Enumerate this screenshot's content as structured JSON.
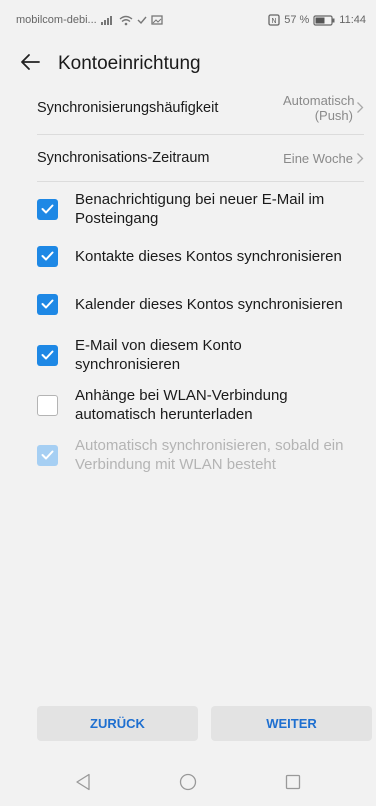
{
  "status_bar": {
    "carrier": "mobilcom-debi...",
    "battery_percent": "57 %",
    "time": "11:44"
  },
  "header": {
    "title": "Kontoeinrichtung"
  },
  "settings": {
    "sync_frequency": {
      "label": "Synchronisierungshäufigkeit",
      "value_line1": "Automatisch",
      "value_line2": "(Push)"
    },
    "sync_period": {
      "label": "Synchronisations-Zeitraum",
      "value": "Eine Woche"
    }
  },
  "options": [
    {
      "line1": "Benachrichtigung bei neuer E-Mail im",
      "line2": "Posteingang",
      "checked": true,
      "disabled": false
    },
    {
      "line1": "Kontakte dieses Kontos synchronisieren",
      "line2": "",
      "checked": true,
      "disabled": false
    },
    {
      "line1": "Kalender dieses Kontos synchronisieren",
      "line2": "",
      "checked": true,
      "disabled": false
    },
    {
      "line1": "E-Mail von diesem Konto",
      "line2": "synchronisieren",
      "checked": true,
      "disabled": false
    },
    {
      "line1": "Anhänge bei WLAN-Verbindung",
      "line2": "automatisch herunterladen",
      "checked": false,
      "disabled": false
    },
    {
      "line1": "Automatisch synchronisieren, sobald ein",
      "line2": "Verbindung mit WLAN besteht",
      "checked": true,
      "disabled": true
    }
  ],
  "buttons": {
    "back": "ZURÜCK",
    "next": "WEITER"
  },
  "colors": {
    "accent": "#1e88e5",
    "button_text": "#1e6fd0",
    "disabled_check": "#a6cff3",
    "background": "#f2f2f2"
  },
  "icons": {
    "back": "arrow-left-icon",
    "chevron": "chevron-right-icon",
    "nav_back": "triangle-back-icon",
    "nav_home": "circle-home-icon",
    "nav_recent": "square-recent-icon"
  }
}
